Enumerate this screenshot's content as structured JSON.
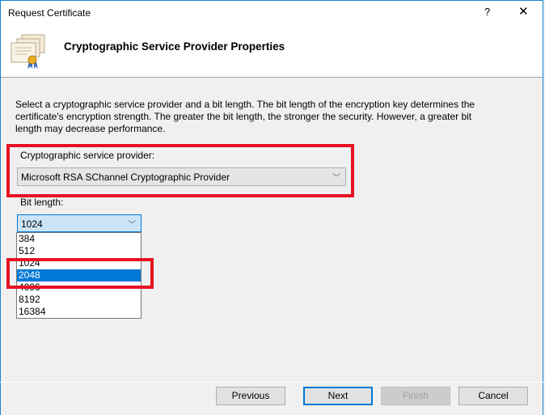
{
  "window": {
    "title": "Request Certificate",
    "help_label": "?",
    "close_label": "✕"
  },
  "header": {
    "icon": "certificates-icon",
    "title": "Cryptographic Service Provider Properties"
  },
  "description": "Select a cryptographic service provider and a bit length. The bit length of the encryption key determines the certificate's encryption strength. The greater the bit length, the stronger the security. However, a greater bit length may decrease performance.",
  "provider": {
    "label": "Cryptographic service provider:",
    "value": "Microsoft RSA SChannel Cryptographic Provider"
  },
  "bit_length": {
    "label": "Bit length:",
    "value": "1024",
    "options": [
      "384",
      "512",
      "1024",
      "2048",
      "4096",
      "8192",
      "16384"
    ],
    "highlighted": "2048"
  },
  "buttons": {
    "previous": "Previous",
    "next": "Next",
    "finish": "Finish",
    "cancel": "Cancel"
  },
  "colors": {
    "accent": "#0078d7",
    "annotation": "#e81123"
  }
}
